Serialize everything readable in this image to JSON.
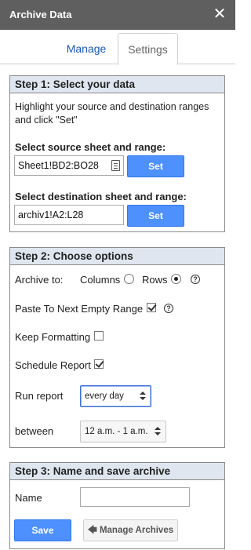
{
  "window": {
    "title": "Archive Data",
    "close_icon": "close-icon"
  },
  "tabs": {
    "manage": "Manage",
    "settings": "Settings",
    "active": "Settings"
  },
  "step1": {
    "header": "Step 1: Select your data",
    "description": "Highlight your source and destination ranges and click \"Set\"",
    "source_label": "Select source sheet and range:",
    "source_value": "Sheet1!BD2:BO28",
    "destination_label": "Select destination sheet and range:",
    "destination_value": "archiv1!A2:L28",
    "set_label": "Set"
  },
  "step2": {
    "header": "Step 2: Choose options",
    "archive_to_label": "Archive to:",
    "columns_label": "Columns",
    "rows_label": "Rows",
    "archive_to_selected": "Rows",
    "paste_label": "Paste To Next Empty Range",
    "paste_checked": true,
    "keep_formatting_label": "Keep Formatting",
    "keep_formatting_checked": false,
    "schedule_label": "Schedule Report",
    "schedule_checked": true,
    "run_report_label": "Run report",
    "run_report_value": "every day",
    "between_label": "between",
    "between_value": "12 a.m. - 1 a.m.",
    "help_glyph": "?"
  },
  "step3": {
    "header": "Step 3: Name and save archive",
    "name_label": "Name",
    "name_value": "",
    "save_label": "Save",
    "manage_archives_label": "Manage Archives",
    "manage_archives_icon": "arrow-left-icon"
  },
  "colors": {
    "titlebar": "#5f5f5f",
    "section_header": "#dfe6ef",
    "primary_button": "#4d90fe",
    "tab_link": "#1a57b8"
  }
}
